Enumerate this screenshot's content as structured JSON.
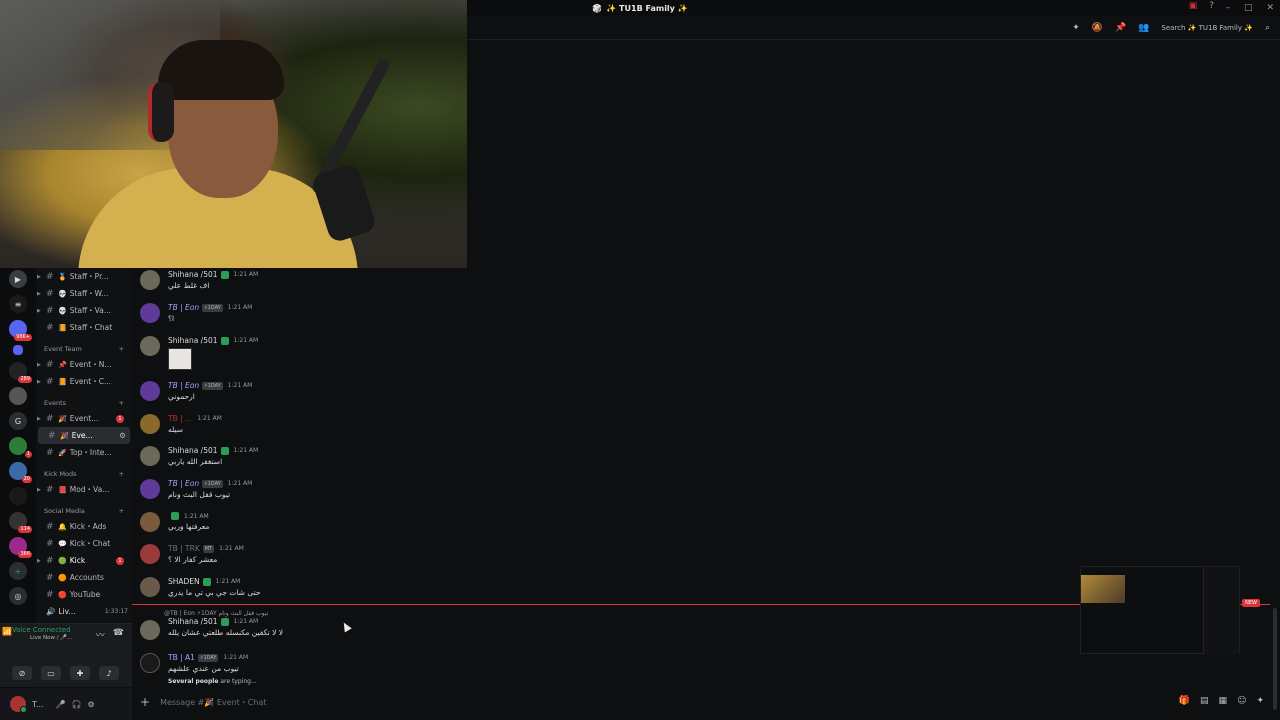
{
  "window": {
    "title": "✨ TU1B Family ✨"
  },
  "header": {
    "search_label": "Search ✨ TU1B Family ✨"
  },
  "sidebar": {
    "channels": [
      {
        "name": "Staff・Pr...",
        "type": "text",
        "emoji": "🏅"
      },
      {
        "name": "Staff・W...",
        "type": "text",
        "emoji": "💀"
      },
      {
        "name": "Staff・Va...",
        "type": "text",
        "emoji": "💀"
      },
      {
        "name": "Staff・Chat",
        "type": "text",
        "emoji": "📙"
      }
    ],
    "event_team": {
      "label": "Event Team",
      "channels": [
        {
          "name": "Event・N...",
          "emoji": "📌"
        },
        {
          "name": "Event・C...",
          "emoji": "📙"
        }
      ]
    },
    "events": {
      "label": "Events",
      "channels": [
        {
          "name": "Event...",
          "emoji": "🎉",
          "unread": "1"
        },
        {
          "name": "Eve...",
          "emoji": "🎉",
          "active": true
        },
        {
          "name": "Top・Inte...",
          "emoji": "🚀"
        }
      ]
    },
    "kick_mods": {
      "label": "Kick Mods",
      "channels": [
        {
          "name": "Mod・Va...",
          "emoji": "📕"
        }
      ]
    },
    "social_media": {
      "label": "Social Media",
      "channels": [
        {
          "name": "Kick・Ads",
          "emoji": "🔔"
        },
        {
          "name": "Kick・Chat",
          "emoji": "💬"
        },
        {
          "name": "Kick",
          "emoji": "🟢",
          "unread": "1"
        },
        {
          "name": "Accounts",
          "emoji": "🟠"
        },
        {
          "name": "YouTube",
          "emoji": "🔴"
        }
      ]
    },
    "live_channel": {
      "name": "Liv...",
      "time": "1:33:17"
    }
  },
  "servers": {
    "badges": [
      "98K+",
      "289",
      "1",
      "20",
      "114",
      "366"
    ],
    "letter": "G"
  },
  "voice": {
    "status": "Voice Connected",
    "sub": "Live Now / 🎤..."
  },
  "user": {
    "name": "T..."
  },
  "messages": [
    {
      "name": "Shihana /501",
      "time": "1:21 AM",
      "text": "اف غلط علي"
    },
    {
      "name": "TB | Eon",
      "badge": "⚡1DAY",
      "time": "1:21 AM",
      "text": "ا؟"
    },
    {
      "name": "Shihana /501",
      "time": "1:21 AM",
      "text": ""
    },
    {
      "name": "TB | Eon",
      "badge": "⚡1DAY",
      "time": "1:21 AM",
      "text": "ارحموني"
    },
    {
      "name": "TB | ...",
      "time": "1:21 AM",
      "text": "سيله"
    },
    {
      "name": "Shihana /501",
      "time": "1:21 AM",
      "text": "استغفر الله ياربي"
    },
    {
      "name": "TB | Eon",
      "badge": "⚡1DAY",
      "time": "1:21 AM",
      "text": "تيوب قفل البث ونام"
    },
    {
      "name": "",
      "time": "1:21 AM",
      "text": "معرفتها وربي"
    },
    {
      "name": "TB | TRK",
      "badge": "MT",
      "time": "1:21 AM",
      "text": "معشر كفار الا ؟"
    },
    {
      "name": "SHADEN",
      "time": "1:21 AM",
      "text": "حتى شات جي بي تي ما يدري"
    },
    {
      "name": "Shihana /501",
      "time": "1:21 AM",
      "text": "لا لا تكفين مكنسله طلعتي عشان يلله",
      "reply": "@TB | Eon ⚡1DAY تيوب قفل البث ونام"
    },
    {
      "name": "TB | A1",
      "badge": "⚡1DAY",
      "time": "1:21 AM",
      "text": "تيوب من عندي علشهم"
    }
  ],
  "new_label": "NEW",
  "typing": {
    "bold": "Several people",
    "rest": " are typing..."
  },
  "composer": {
    "placeholder": "Message #🎉 Event・Chat"
  }
}
